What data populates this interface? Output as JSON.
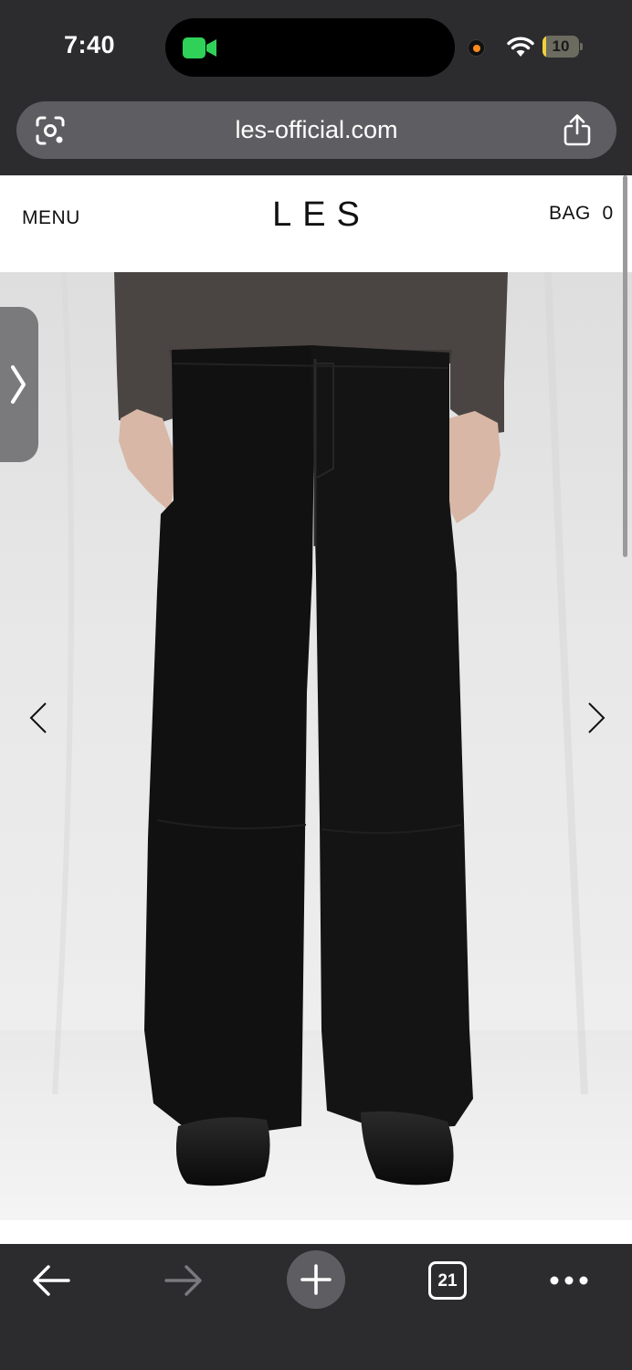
{
  "status_bar": {
    "time": "7:40",
    "battery_level": 10,
    "battery_label": "10",
    "colors": {
      "facetime": "#30d158",
      "record_dot": "#ff8a1e",
      "battery": "#f2cf3b"
    }
  },
  "browser": {
    "url": "les-official.com",
    "tab_count": "21",
    "icons": [
      "lens-icon",
      "share-icon",
      "back-arrow-icon",
      "forward-arrow-icon",
      "plus-icon",
      "tabs-icon",
      "more-icon"
    ]
  },
  "site": {
    "menu_label": "MENU",
    "logo": "LES",
    "bag_label": "BAG",
    "bag_count": "0"
  },
  "product_gallery": {
    "image": "model-wearing-black-wide-trousers",
    "icons": [
      "chevron-left-icon",
      "chevron-right-icon"
    ]
  }
}
